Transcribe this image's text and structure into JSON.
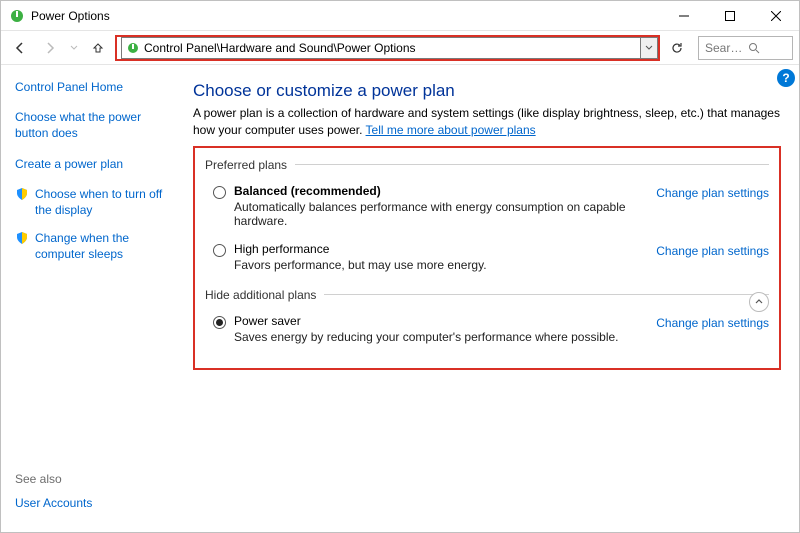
{
  "window": {
    "title": "Power Options"
  },
  "toolbar": {
    "address": "Control Panel\\Hardware and Sound\\Power Options",
    "search_placeholder": "Search Co..."
  },
  "sidebar": {
    "home": "Control Panel Home",
    "links": [
      "Choose what the power button does",
      "Create a power plan",
      "Choose when to turn off the display",
      "Change when the computer sleeps"
    ],
    "see_also_header": "See also",
    "see_also_link": "User Accounts"
  },
  "main": {
    "title": "Choose or customize a power plan",
    "desc_prefix": "A power plan is a collection of hardware and system settings (like display brightness, sleep, etc.) that manages how your computer uses power. ",
    "desc_link": "Tell me more about power plans",
    "preferred_legend": "Preferred plans",
    "additional_legend": "Hide additional plans",
    "change_label": "Change plan settings",
    "plans": {
      "balanced": {
        "name": "Balanced (recommended)",
        "desc": "Automatically balances performance with energy consumption on capable hardware."
      },
      "high": {
        "name": "High performance",
        "desc": "Favors performance, but may use more energy."
      },
      "saver": {
        "name": "Power saver",
        "desc": "Saves energy by reducing your computer's performance where possible."
      }
    }
  }
}
